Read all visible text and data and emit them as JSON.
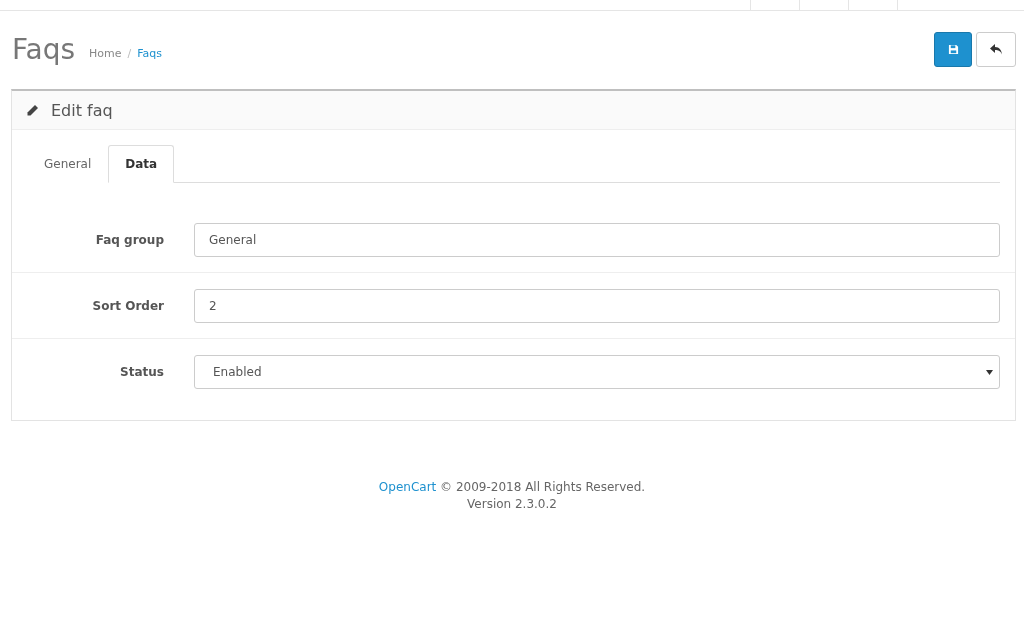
{
  "page": {
    "title": "Faqs",
    "breadcrumb_separator": "/",
    "breadcrumb": [
      {
        "label": "Home",
        "current": false
      },
      {
        "label": "Faqs",
        "current": true
      }
    ]
  },
  "panel": {
    "title": "Edit faq"
  },
  "tabs": [
    {
      "label": "General",
      "selected": false
    },
    {
      "label": "Data",
      "selected": true
    }
  ],
  "fields": [
    {
      "kind": "input",
      "label": "Faq group",
      "value": "General"
    },
    {
      "kind": "input",
      "label": "Sort Order",
      "value": "2"
    },
    {
      "kind": "select",
      "label": "Status",
      "value": "Enabled"
    }
  ],
  "footer": {
    "link": "OpenCart",
    "text": "© 2009-2018 All Rights Reserved.",
    "version": "Version 2.3.0.2"
  }
}
